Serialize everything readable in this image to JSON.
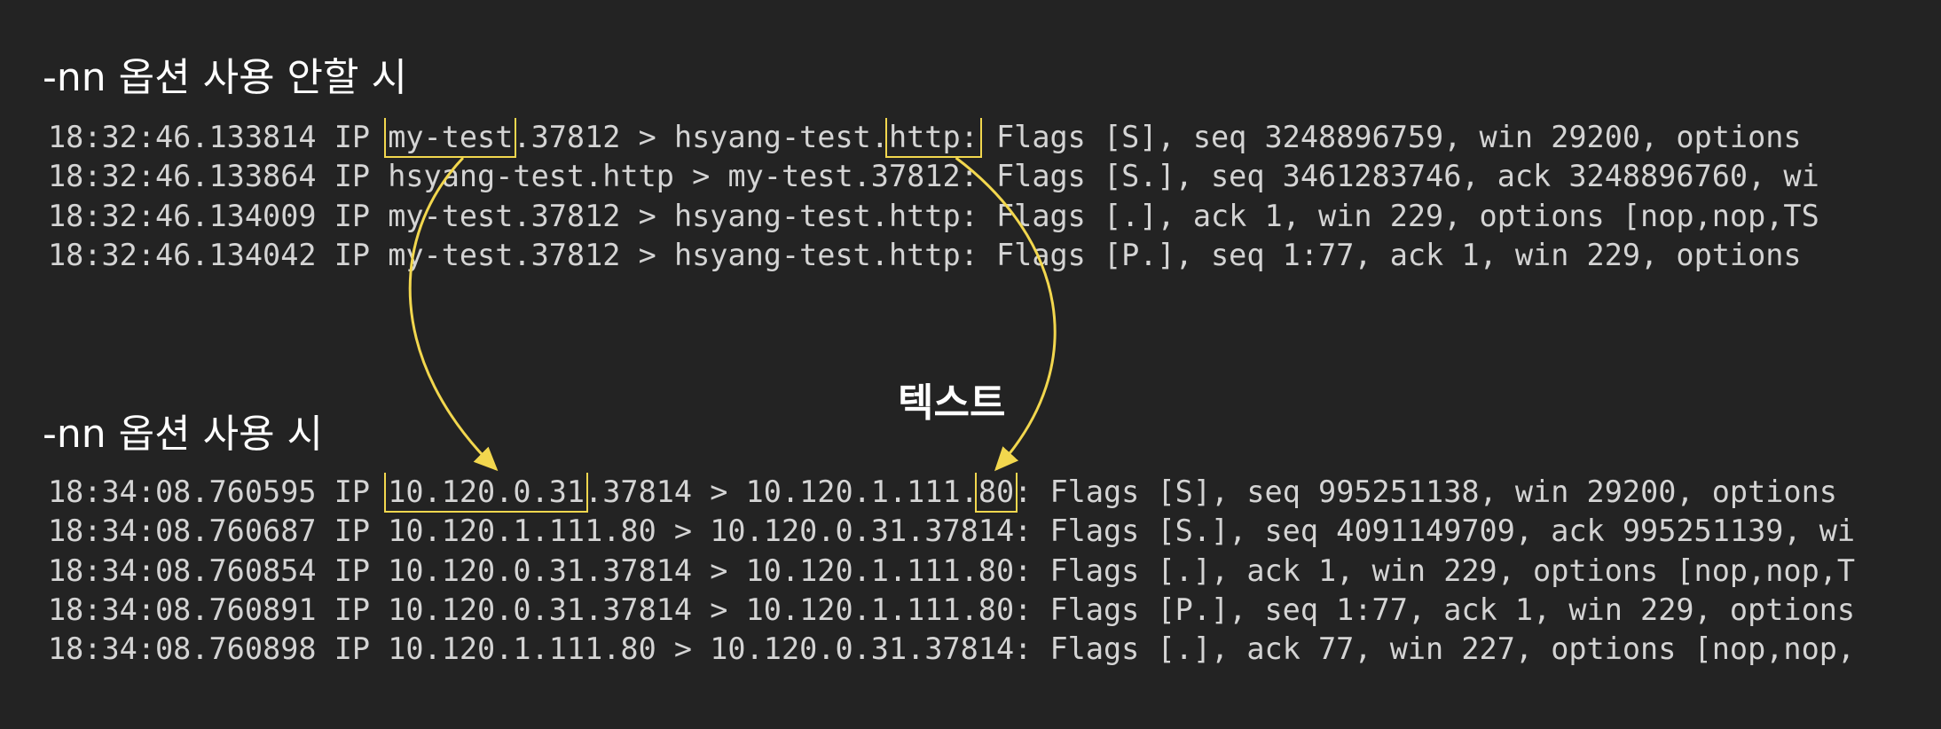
{
  "colors": {
    "background": "#232323",
    "text": "#d4d4d4",
    "highlight": "#f2d74e"
  },
  "headings": {
    "without_nn": "-nn 옵션 사용 안할 시",
    "with_nn": "-nn 옵션 사용 시"
  },
  "annotation_label": "텍스트",
  "without_nn_lines": [
    {
      "ts": "18:32:46.133814",
      "p": "IP",
      "src_host": "my-test",
      "src_port": ".37812",
      "gt": ">",
      "dst_host": "hsyang-test.",
      "dst_port": "http:",
      "tail": "Flags [S], seq 3248896759, win 29200, options"
    },
    {
      "ts": "18:32:46.133864",
      "p": "IP",
      "src_host": "hsyang-test.http",
      "src_port": "",
      "gt": ">",
      "dst_host": "my-test.37812:",
      "dst_port": "",
      "tail": "Flags [S.], seq 3461283746, ack 3248896760, wi"
    },
    {
      "ts": "18:32:46.134009",
      "p": "IP",
      "src_host": "my-test.37812",
      "src_port": "",
      "gt": ">",
      "dst_host": "hsyang-test.http:",
      "dst_port": "",
      "tail": "Flags [.], ack 1, win 229, options [nop,nop,TS"
    },
    {
      "ts": "18:32:46.134042",
      "p": "IP",
      "src_host": "my-test.37812",
      "src_port": "",
      "gt": ">",
      "dst_host": "hsyang-test.http:",
      "dst_port": "",
      "tail": "Flags [P.], seq 1:77, ack 1, win 229, options"
    }
  ],
  "with_nn_lines": [
    {
      "ts": "18:34:08.760595",
      "p": "IP",
      "src_host": "10.120.0.31",
      "src_port": ".37814",
      "gt": ">",
      "dst_host": "10.120.1.111.",
      "dst_port": "80",
      "colon": ":",
      "tail": "Flags [S], seq 995251138, win 29200, options"
    },
    {
      "ts": "18:34:08.760687",
      "p": "IP",
      "src_host": "10.120.1.111.80",
      "src_port": "",
      "gt": ">",
      "dst_host": "10.120.0.31.37814:",
      "dst_port": "",
      "colon": "",
      "tail": "Flags [S.], seq 4091149709, ack 995251139, wi"
    },
    {
      "ts": "18:34:08.760854",
      "p": "IP",
      "src_host": "10.120.0.31.37814",
      "src_port": "",
      "gt": ">",
      "dst_host": "10.120.1.111.80:",
      "dst_port": "",
      "colon": "",
      "tail": "Flags [.], ack 1, win 229, options [nop,nop,T"
    },
    {
      "ts": "18:34:08.760891",
      "p": "IP",
      "src_host": "10.120.0.31.37814",
      "src_port": "",
      "gt": ">",
      "dst_host": "10.120.1.111.80:",
      "dst_port": "",
      "colon": "",
      "tail": "Flags [P.], seq 1:77, ack 1, win 229, options"
    },
    {
      "ts": "18:34:08.760898",
      "p": "IP",
      "src_host": "10.120.1.111.80",
      "src_port": "",
      "gt": ">",
      "dst_host": "10.120.0.31.37814:",
      "dst_port": "",
      "colon": "",
      "tail": "Flags [.], ack 77, win 227, options [nop,nop,"
    }
  ]
}
